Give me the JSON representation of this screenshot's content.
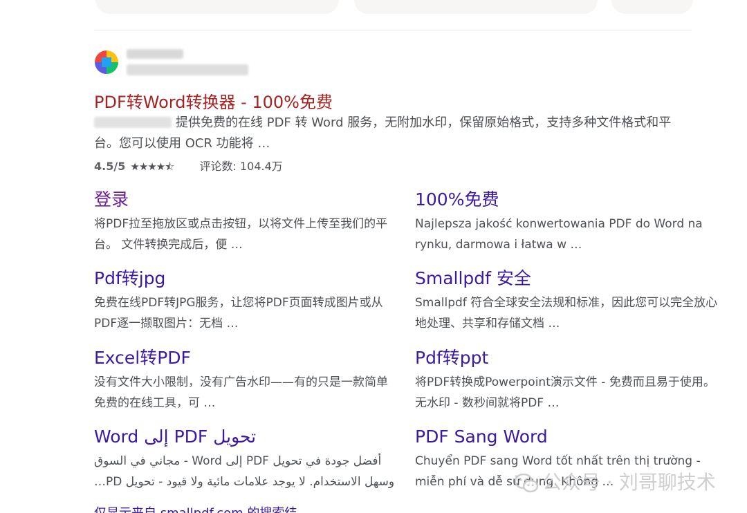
{
  "result": {
    "title": "PDF转Word转换器 - 100%免费",
    "description": "提供免费的在线 PDF 转 Word 服务，无附加水印，保留原始格式，支持多种文件格式和平台。您可以使用 OCR 功能将 …",
    "rating_score": "4.5/5",
    "stars": "★★★★⯪",
    "reviews": "评论数: 104.4万"
  },
  "sitelinks": [
    {
      "title": "登录",
      "desc": "将PDF拉至拖放区或点击按钮，以将文件上传至我们的平台。 文件转换完成后，便 …"
    },
    {
      "title": "100%免费",
      "desc": "Najlepsza jakość konwertowania PDF do Word na rynku, darmowa i łatwa w …"
    },
    {
      "title": "Pdf转jpg",
      "desc": "免费在线PDF转JPG服务，让您将PDF页面转成图片或从PDF逐一撷取图片：无档 …"
    },
    {
      "title": "Smallpdf 安全",
      "desc": "Smallpdf 符合全球安全法规和标准，因此您可以完全放心地处理、共享和存储文档 …"
    },
    {
      "title": "Excel转PDF",
      "desc": "没有文件大小限制，没有广告水印——有的只是一款简单免费的在线工具，可 …"
    },
    {
      "title": "Pdf转ppt",
      "desc": "将PDF转换成Powerpoint演示文件 - 免费而且易于使用。无水印 - 数秒间就将PDF …"
    },
    {
      "title": "تحويل PDF إلى Word",
      "desc": "أفضل جودة في تحويل PDF إلى Word - مجاني في السوق وسهل الاستخدام. لا يوجد علامات مائية ولا قيود - تحويل PD…"
    },
    {
      "title": "PDF Sang Word",
      "desc": "Chuyển PDF sang Word tốt nhất trên thị trường - miễn phí và dễ sử dụng. Không …"
    }
  ],
  "cutoff_text": "仅显示来自 smallpdf.com 的搜索结果",
  "watermark": "公众号 · 刘哥聊技术"
}
